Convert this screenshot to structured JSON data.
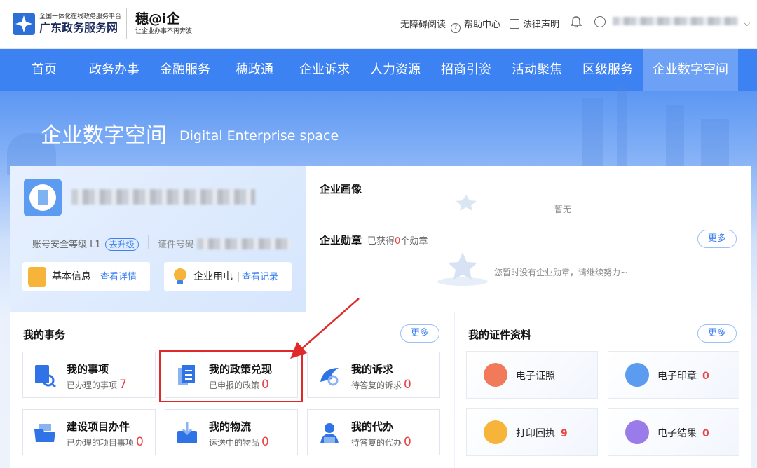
{
  "header": {
    "platform_subtitle": "全国一体化在线政务服务平台",
    "platform_name": "广东政务服务网",
    "brand_name": "穗@i企",
    "brand_slogan": "让企业办事不再奔波",
    "links": {
      "accessibility": "无障碍阅读",
      "help": "帮助中心",
      "legal": "法律声明"
    }
  },
  "nav": {
    "items": [
      "首页",
      "政务办事",
      "金融服务",
      "穗政通",
      "企业诉求",
      "人力资源",
      "招商引资",
      "活动聚焦",
      "区级服务",
      "企业数字空间"
    ],
    "active": "企业数字空间"
  },
  "hero": {
    "title": "企业数字空间",
    "subtitle": "Digital Enterprise space"
  },
  "profile": {
    "security_label": "账号安全等级 L1",
    "upgrade_label": "去升级",
    "cert_label": "证件号码",
    "basic_info": {
      "label": "基本信息",
      "link": "查看详情"
    },
    "power": {
      "label": "企业用电",
      "link": "查看记录"
    }
  },
  "portrait": {
    "title": "企业画像",
    "empty": "暂无"
  },
  "medals": {
    "title": "企业勋章",
    "earned_prefix": "已获得",
    "earned_count": "0",
    "earned_suffix": "个勋章",
    "empty": "您暂时没有企业勋章，请继续努力~",
    "more": "更多"
  },
  "affairs": {
    "title": "我的事务",
    "more": "更多",
    "cards": [
      {
        "title": "我的事项",
        "desc": "已办理的事项",
        "count": "7"
      },
      {
        "title": "我的政策兑现",
        "desc": "已申报的政策",
        "count": "0"
      },
      {
        "title": "我的诉求",
        "desc": "待答复的诉求",
        "count": "0"
      },
      {
        "title": "建设项目办件",
        "desc": "已办理的项目事项",
        "count": "0"
      },
      {
        "title": "我的物流",
        "desc": "运送中的物品",
        "count": "0"
      },
      {
        "title": "我的代办",
        "desc": "待答复的代办",
        "count": "0"
      }
    ]
  },
  "certs": {
    "title": "我的证件资料",
    "more": "更多",
    "cards": [
      {
        "title": "电子证照",
        "count": ""
      },
      {
        "title": "电子印章",
        "count": "0"
      },
      {
        "title": "打印回执",
        "count": "9"
      },
      {
        "title": "电子结果",
        "count": "0"
      }
    ]
  },
  "colors": {
    "primary": "#3d82f2",
    "accent_red": "#e94444",
    "highlight_box": "#e02a2a"
  }
}
